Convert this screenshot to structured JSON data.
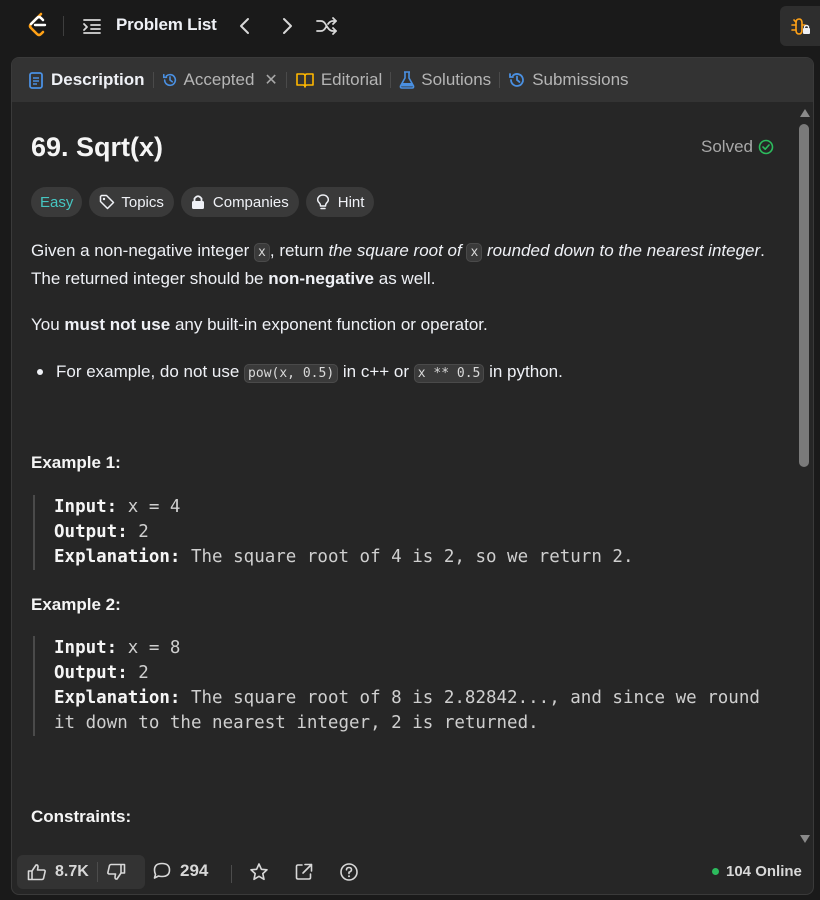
{
  "topbar": {
    "problem_list_label": "Problem List"
  },
  "tabs": [
    {
      "label": "Description"
    },
    {
      "label": "Accepted"
    },
    {
      "label": "Editorial"
    },
    {
      "label": "Solutions"
    },
    {
      "label": "Submissions"
    }
  ],
  "problem": {
    "title": "69. Sqrt(x)",
    "status": "Solved",
    "difficulty": "Easy",
    "chips": {
      "topics": "Topics",
      "companies": "Companies",
      "hint": "Hint"
    },
    "desc1": {
      "a": "Given a non-negative integer ",
      "code1": "x",
      "b": ", return ",
      "c": "the square root of ",
      "code2": "x",
      "d": " rounded down to the nearest integer",
      "e": ". The returned integer should be ",
      "f": "non-negative",
      "g": " as well."
    },
    "desc2": {
      "a": "You ",
      "b": "must not use",
      "c": " any built-in exponent function or operator."
    },
    "bullet": {
      "a": "For example, do not use ",
      "code1": "pow(x, 0.5)",
      "b": " in c++ or ",
      "code2": "x ** 0.5",
      "c": " in python."
    },
    "examples": [
      {
        "title": "Example 1:",
        "input_key": "Input:",
        "input": " x = 4",
        "output_key": "Output:",
        "output": " 2",
        "expl_key": "Explanation:",
        "expl": " The square root of 4 is 2, so we return 2."
      },
      {
        "title": "Example 2:",
        "input_key": "Input:",
        "input": " x = 8",
        "output_key": "Output:",
        "output": " 2",
        "expl_key": "Explanation:",
        "expl": " The square root of 8 is 2.82842..., and since we round",
        "expl2": "it down to the nearest integer, 2 is returned."
      }
    ],
    "constraints_title": "Constraints:"
  },
  "footer": {
    "likes": "8.7K",
    "comments": "294",
    "online": "104 Online"
  },
  "colors": {
    "easy": "#46c6c2",
    "accent_blue": "#4a90e2",
    "solved_green": "#2cbb5d",
    "editorial_yellow": "#ffb800"
  }
}
